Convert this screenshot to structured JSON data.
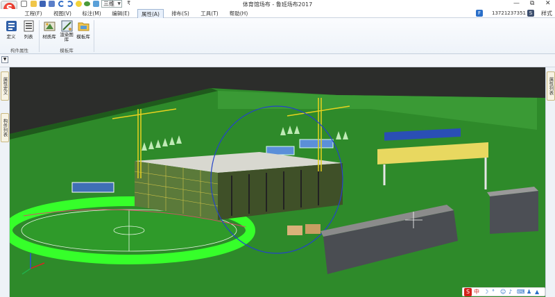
{
  "window": {
    "title": "体育馆场布 - 鲁班场布2017",
    "view_mode": "三维",
    "qa_more": "₹",
    "min_btn": "—",
    "restore_btn": "⧉",
    "close_btn": "✕"
  },
  "menu": {
    "tabs": [
      {
        "label": "工程(F)"
      },
      {
        "label": "视图(V)"
      },
      {
        "label": "标注(M)"
      },
      {
        "label": "编辑(E)"
      },
      {
        "label": "属性(A)"
      },
      {
        "label": "排布(S)"
      },
      {
        "label": "工具(T)"
      },
      {
        "label": "帮助(H)"
      }
    ],
    "active_index": 4
  },
  "account": {
    "user": "13721237351",
    "style_label": "样式"
  },
  "ribbon": {
    "groups": [
      {
        "label": "构件属性",
        "buttons": [
          {
            "label": "定义"
          },
          {
            "label": "列表"
          }
        ]
      },
      {
        "label": "模板库",
        "buttons": [
          {
            "label": "材质库"
          },
          {
            "label": "渲染图库"
          },
          {
            "label": "模板库"
          }
        ]
      }
    ]
  },
  "side_panels": {
    "left_tabs": [
      "属性定义",
      "构件列表"
    ],
    "right_tabs": [
      "属性列表"
    ]
  },
  "ime": {
    "logo": "S",
    "lang": "中"
  },
  "colors": {
    "grass": "#2e8a2a",
    "track": "#36ff2a",
    "accent_blue": "#2a6fc9",
    "brand_red": "#d2201a",
    "crane_yellow": "#e8d21e"
  }
}
